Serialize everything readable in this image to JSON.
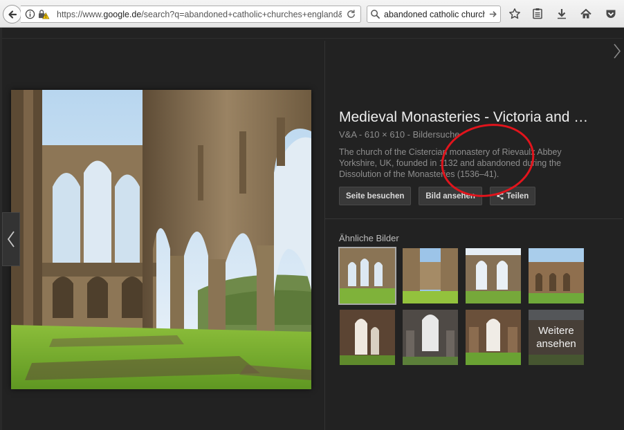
{
  "browser": {
    "url_prefix": "https://www.",
    "url_domain": "google.de",
    "url_rest": "/search?q=abandoned+catholic+churches+england&cli",
    "search_text": "abandoned catholic churches er"
  },
  "preview": {
    "title": "Medieval Monasteries - Victoria and …",
    "meta": "V&A - 610 × 610 - Bildersuche",
    "description": "The church of the Cistercian monastery of Rievaulx Abbey Yorkshire, UK, founded in 1132 and abandoned during the Dissolution of the Monasteries (1536–41).",
    "buttons": {
      "visit": "Seite besuchen",
      "view": "Bild ansehen",
      "share": "Teilen"
    },
    "similar_label": "Ähnliche Bilder",
    "more_label": "Weitere ansehen",
    "annotation_color": "#e1141c"
  },
  "icons": [
    "back-arrow-icon",
    "info-icon",
    "lock-warning-icon",
    "reload-icon",
    "search-icon",
    "go-arrow-icon",
    "star-icon",
    "reading-list-icon",
    "download-icon",
    "home-icon",
    "pocket-icon",
    "chevron-left-icon",
    "chevron-right-icon",
    "share-icon"
  ]
}
